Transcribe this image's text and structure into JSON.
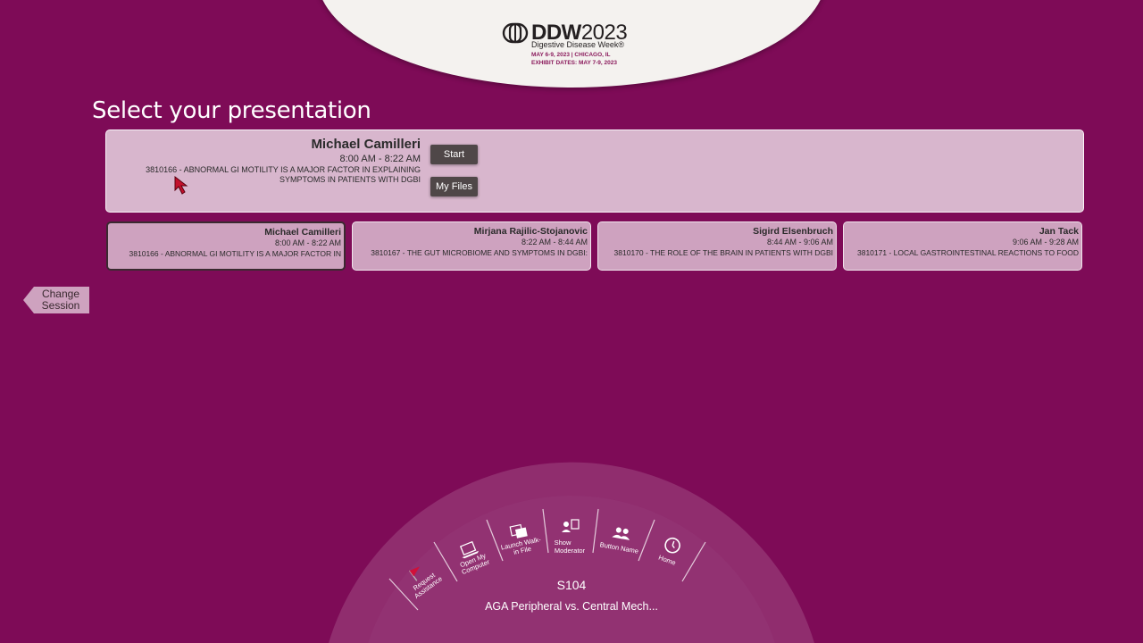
{
  "logo": {
    "brand": "DDW",
    "year": "2023",
    "subtitle": "Digestive Disease Week®",
    "dates": "MAY 6-9, 2023 | CHICAGO, IL",
    "exhibit": "EXHIBIT DATES: MAY 7-9, 2023"
  },
  "page_title": "Select your presentation",
  "featured": {
    "name": "Michael Camilleri",
    "time": "8:00 AM - 8:22 AM",
    "desc_line1": "3810166 - ABNORMAL GI MOTILITY IS A MAJOR FACTOR IN EXPLAINING",
    "desc_line2": "SYMPTOMS IN PATIENTS WITH DGBI",
    "start_label": "Start",
    "files_label": "My Files"
  },
  "presentations": [
    {
      "name": "Michael Camilleri",
      "time": "8:00 AM - 8:22 AM",
      "desc": "3810166 - ABNORMAL GI MOTILITY IS A MAJOR FACTOR IN"
    },
    {
      "name": "Mirjana Rajilic-Stojanovic",
      "time": "8:22 AM - 8:44 AM",
      "desc": "3810167 - THE GUT MICROBIOME AND SYMPTOMS IN DGBI:"
    },
    {
      "name": "Sigird Elsenbruch",
      "time": "8:44 AM - 9:06 AM",
      "desc": "3810170 - THE ROLE OF THE BRAIN IN PATIENTS WITH DGBI"
    },
    {
      "name": "Jan Tack",
      "time": "9:06 AM - 9:28 AM",
      "desc": "3810171 - LOCAL GASTROINTESTINAL REACTIONS TO FOOD"
    }
  ],
  "change_session": {
    "line1": "Change",
    "line2": "Session"
  },
  "arc_menu": {
    "items": [
      {
        "label1": "Request",
        "label2": "Assistance",
        "icon": "flag-icon"
      },
      {
        "label1": "Open My",
        "label2": "Computer",
        "icon": "laptop-icon"
      },
      {
        "label1": "Launch Walk-",
        "label2": "in File",
        "icon": "images-icon"
      },
      {
        "label1": "Show",
        "label2": "Moderator",
        "icon": "moderator-icon"
      },
      {
        "label1": "Button Name",
        "label2": "",
        "icon": "people-icon"
      },
      {
        "label1": "Home",
        "label2": "",
        "icon": "clock-icon"
      }
    ],
    "room": "S104",
    "session": "AGA Peripheral vs. Central Mech..."
  },
  "colors": {
    "background": "#7e0b57",
    "accent": "#8a1a5c",
    "flag": "#d0103a"
  }
}
